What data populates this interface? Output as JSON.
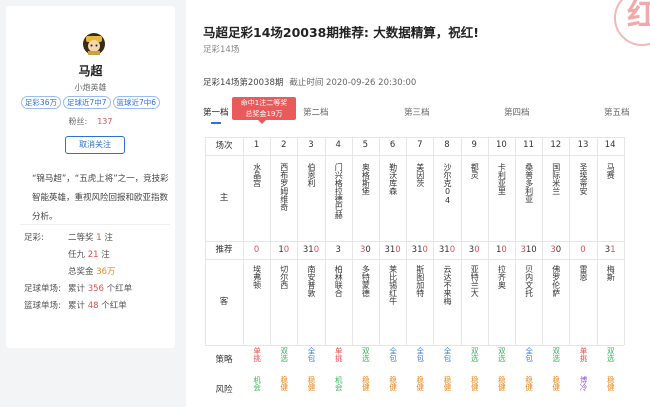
{
  "profile": {
    "name": "马超",
    "title": "小炮英雄",
    "tags": [
      "足彩36万",
      "足球近7中7",
      "篮球近7中6"
    ],
    "fans_label": "粉丝:",
    "fans_count": "137",
    "follow_label": "取消关注",
    "description": "“锦马超”，“五虎上将”之一，竞技彩智能英雄，重视风险回报和欧亚指数分析。",
    "stats": {
      "zucai_label": "足彩:",
      "zucai_line1_pre": "二等奖",
      "zucai_line1_num": "1",
      "zucai_line1_post": "注",
      "zucai_line2_pre": "任九",
      "zucai_line2_num": "21",
      "zucai_line2_post": "注",
      "zucai_line3_pre": "总奖金",
      "zucai_line3_num": "36万",
      "football_label": "足球单场:",
      "football_pre": "累计",
      "football_num": "356",
      "football_post": "个红单",
      "basketball_label": "篮球单场:",
      "basketball_pre": "累计",
      "basketball_num": "48",
      "basketball_post": "个红单"
    }
  },
  "article": {
    "title": "马超足彩14场20038期推荐: 大数据精算，祝红!",
    "subtitle": "足彩14场",
    "stamp": "红",
    "issue": "足彩14场第20038期",
    "time": "截止时间 2020-09-26 20:30:00"
  },
  "tabs": {
    "items": [
      "第一档",
      "第二档",
      "第三档",
      "第四档",
      "第五档"
    ],
    "bubble_line1": "命中1注二等奖",
    "bubble_line2": "总奖金19万"
  },
  "table": {
    "header_label": "场次",
    "home_label": "主",
    "pick_label": "推荐",
    "away_label": "客",
    "strategy_label": "策略",
    "risk_label": "风险",
    "matches": [
      {
        "no": "1",
        "home": "水晶宫",
        "pick": [
          {
            "t": "0",
            "h": true
          }
        ],
        "away": "埃弗顿",
        "strategy": {
          "t": "单挑",
          "c": "red"
        },
        "risk": {
          "t": "机会",
          "c": "green"
        }
      },
      {
        "no": "2",
        "home": "西布罗姆维奇",
        "pick": [
          {
            "t": "1",
            "h": false
          },
          {
            "t": "0",
            "h": true
          }
        ],
        "away": "切尔西",
        "strategy": {
          "t": "双选",
          "c": "green"
        },
        "risk": {
          "t": "稳健",
          "c": "orange"
        }
      },
      {
        "no": "3",
        "home": "伯恩利",
        "pick": [
          {
            "t": "31",
            "h": false
          },
          {
            "t": "0",
            "h": true
          }
        ],
        "away": "南安普敦",
        "strategy": {
          "t": "全包",
          "c": "blue"
        },
        "risk": {
          "t": "稳健",
          "c": "orange"
        }
      },
      {
        "no": "4",
        "home": "门兴格拉德巴赫",
        "pick": [
          {
            "t": "3",
            "h": false
          }
        ],
        "away": "柏林联合",
        "strategy": {
          "t": "单挑",
          "c": "red"
        },
        "risk": {
          "t": "机会",
          "c": "green"
        }
      },
      {
        "no": "5",
        "home": "奥格斯堡",
        "pick": [
          {
            "t": "3",
            "h": true
          },
          {
            "t": "0",
            "h": false
          }
        ],
        "away": "多特蒙德",
        "strategy": {
          "t": "双选",
          "c": "green"
        },
        "risk": {
          "t": "稳健",
          "c": "orange"
        }
      },
      {
        "no": "6",
        "home": "勒沃库森",
        "pick": [
          {
            "t": "31",
            "h": false
          },
          {
            "t": "0",
            "h": true
          }
        ],
        "away": "莱比锡红牛",
        "strategy": {
          "t": "全包",
          "c": "blue"
        },
        "risk": {
          "t": "稳健",
          "c": "orange"
        }
      },
      {
        "no": "7",
        "home": "美因茨",
        "pick": [
          {
            "t": "31",
            "h": false
          },
          {
            "t": "0",
            "h": true
          }
        ],
        "away": "斯图加特",
        "strategy": {
          "t": "全包",
          "c": "blue"
        },
        "risk": {
          "t": "稳健",
          "c": "orange"
        }
      },
      {
        "no": "8",
        "home": "沙尔克04",
        "pick": [
          {
            "t": "31",
            "h": false
          },
          {
            "t": "0",
            "h": true
          }
        ],
        "away": "云达不来梅",
        "strategy": {
          "t": "全包",
          "c": "blue"
        },
        "risk": {
          "t": "稳健",
          "c": "orange"
        }
      },
      {
        "no": "9",
        "home": "都灵",
        "pick": [
          {
            "t": "3",
            "h": false
          },
          {
            "t": "0",
            "h": true
          }
        ],
        "away": "亚特兰大",
        "strategy": {
          "t": "双选",
          "c": "green"
        },
        "risk": {
          "t": "稳健",
          "c": "orange"
        }
      },
      {
        "no": "10",
        "home": "卡利亚里",
        "pick": [
          {
            "t": "1",
            "h": false
          },
          {
            "t": "0",
            "h": true
          }
        ],
        "away": "拉齐奥",
        "strategy": {
          "t": "双选",
          "c": "green"
        },
        "risk": {
          "t": "稳健",
          "c": "orange"
        }
      },
      {
        "no": "11",
        "home": "桑普多利亚",
        "pick": [
          {
            "t": "3",
            "h": true
          },
          {
            "t": "10",
            "h": false
          }
        ],
        "away": "贝内文托",
        "strategy": {
          "t": "全包",
          "c": "blue"
        },
        "risk": {
          "t": "稳健",
          "c": "orange"
        }
      },
      {
        "no": "12",
        "home": "国际米兰",
        "pick": [
          {
            "t": "3",
            "h": true
          },
          {
            "t": "0",
            "h": false
          }
        ],
        "away": "佛罗伦萨",
        "strategy": {
          "t": "双选",
          "c": "green"
        },
        "risk": {
          "t": "稳健",
          "c": "orange"
        }
      },
      {
        "no": "13",
        "home": "圣埃蒂安",
        "pick": [
          {
            "t": "0",
            "h": true
          }
        ],
        "away": "雷恩",
        "strategy": {
          "t": "单挑",
          "c": "red"
        },
        "risk": {
          "t": "博冷",
          "c": "purple"
        }
      },
      {
        "no": "14",
        "home": "马赛",
        "pick": [
          {
            "t": "3",
            "h": false
          },
          {
            "t": "1",
            "h": true
          }
        ],
        "away": "梅斯",
        "strategy": {
          "t": "双选",
          "c": "green"
        },
        "risk": {
          "t": "稳健",
          "c": "orange"
        }
      }
    ]
  },
  "colors": {
    "accent": "#2f6fd6",
    "hit_red": "#e05050",
    "green": "#3bb15a",
    "orange": "#e8891e",
    "purple": "#9b59d0"
  }
}
